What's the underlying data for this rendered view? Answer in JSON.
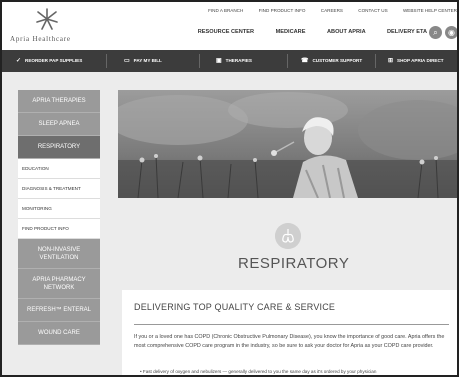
{
  "brand": {
    "name": "Apria Healthcare"
  },
  "top_links": [
    "Find a Branch",
    "Find Product Info",
    "Careers",
    "Contact Us",
    "Website Help Center"
  ],
  "main_nav": [
    "Resource Center",
    "Medicare",
    "About Apria",
    "Delivery ETA"
  ],
  "actions": [
    {
      "icon": "check-icon",
      "glyph": "✓",
      "label": "Reorder PAP Supplies"
    },
    {
      "icon": "credit-card-icon",
      "glyph": "▭",
      "label": "Pay My Bill"
    },
    {
      "icon": "therapies-icon",
      "glyph": "▣",
      "label": "Therapies"
    },
    {
      "icon": "support-icon",
      "glyph": "☎",
      "label": "Customer Support"
    },
    {
      "icon": "cart-icon",
      "glyph": "⊞",
      "label": "Shop Apria Direct"
    }
  ],
  "sidebar": {
    "therapies": "Apria Therapies",
    "sleep_apnea": "Sleep Apnea",
    "respiratory": "Respiratory",
    "sub_items": [
      "Education",
      "Diagnosis & Treatment",
      "Monitoring",
      "Find Product Info"
    ],
    "non_invasive_1": "Non-Invasive",
    "non_invasive_2": "Ventilation",
    "pharmacy_1": "Apria Pharmacy",
    "pharmacy_2": "Network",
    "refresh": "Refresh™ Enteral",
    "wound_care": "Wound Care"
  },
  "section": {
    "title": "RESPIRATORY"
  },
  "card": {
    "heading": "DELIVERING TOP QUALITY CARE & SERVICE",
    "body": "If you or a loved one has COPD (Chronic Obstructive Pulmonary Disease), you know the importance of good care. Apria offers the most comprehensive COPD care program in the industry, so be sure to ask your doctor for Apria as your COPD care provider.",
    "bullet": "Fast delivery of oxygen and nebulizers — generally delivered to you the same day as it's ordered by your physician"
  }
}
